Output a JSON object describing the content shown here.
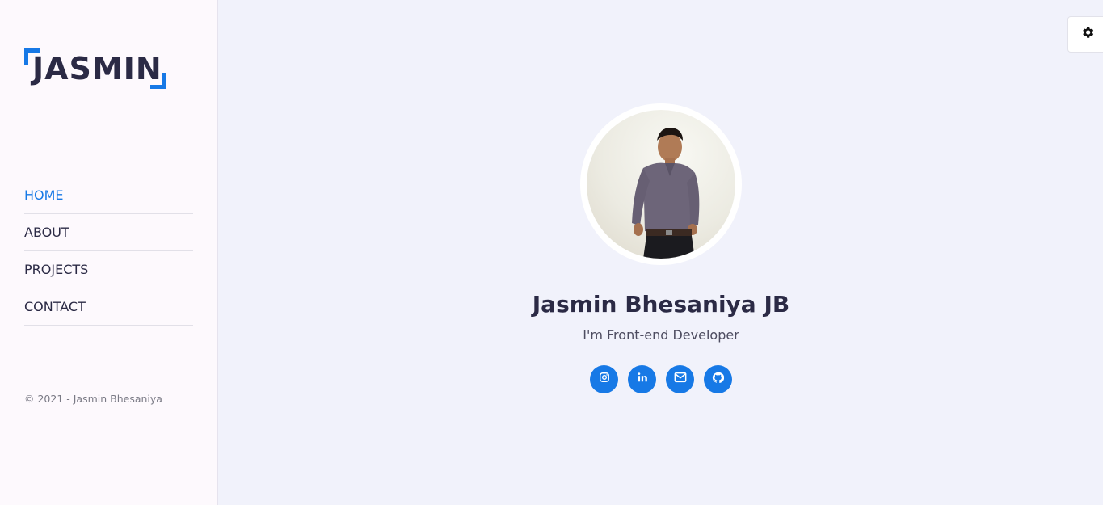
{
  "sidebar": {
    "logo_text": "JASMIN",
    "nav": [
      {
        "label": "HOME",
        "active": true
      },
      {
        "label": "ABOUT",
        "active": false
      },
      {
        "label": "PROJECTS",
        "active": false
      },
      {
        "label": "CONTACT",
        "active": false
      }
    ],
    "copyright": "© 2021 - Jasmin Bhesaniya"
  },
  "settings": {
    "icon": "gear-icon"
  },
  "profile": {
    "name": "Jasmin Bhesaniya JB",
    "role": "I'm Front-end Developer",
    "socials": [
      {
        "icon": "instagram-icon"
      },
      {
        "icon": "linkedin-icon"
      },
      {
        "icon": "email-icon"
      },
      {
        "icon": "github-icon"
      }
    ]
  },
  "colors": {
    "accent": "#1779e6",
    "text": "#2b2a45",
    "background": "#f1f2fb",
    "sidebar_bg": "#fdf9fd"
  }
}
